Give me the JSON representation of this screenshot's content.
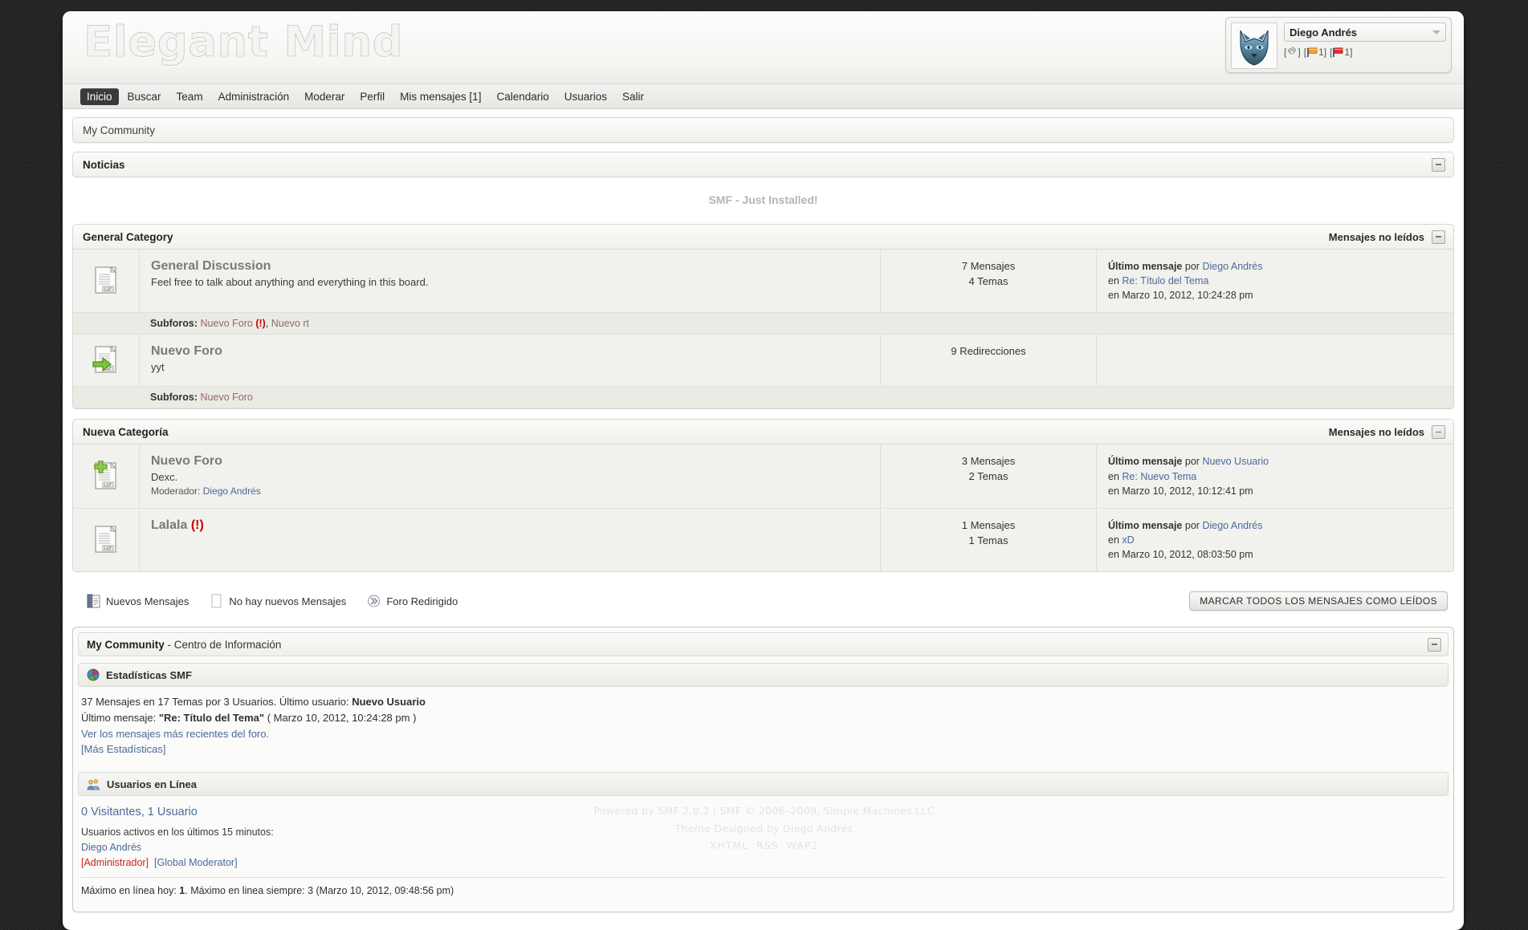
{
  "site": {
    "logo_text": "Elegant Mind",
    "breadcrumb": "My Community"
  },
  "user_panel": {
    "username": "Diego Andrés",
    "avatar_icon": "wolf-avatar",
    "settings_icon": "gear-icon",
    "unread_messages_icon": "orange-flag-icon",
    "unread_messages_count": "1",
    "alerts_icon": "red-flag-icon",
    "alerts_count": "1"
  },
  "nav": {
    "items": [
      {
        "label": "Inicio",
        "active": true
      },
      {
        "label": "Buscar",
        "active": false
      },
      {
        "label": "Team",
        "active": false
      },
      {
        "label": "Administración",
        "active": false
      },
      {
        "label": "Moderar",
        "active": false
      },
      {
        "label": "Perfil",
        "active": false
      },
      {
        "label": "Mis mensajes [1]",
        "active": false
      },
      {
        "label": "Calendario",
        "active": false
      },
      {
        "label": "Usuarios",
        "active": false
      },
      {
        "label": "Salir",
        "active": false
      }
    ]
  },
  "news": {
    "title": "Noticias",
    "text": "SMF - Just Installed!"
  },
  "categories": [
    {
      "title": "General Category",
      "unread_label": "Mensajes no leídos",
      "boards": [
        {
          "icon": "board-off-icon",
          "title": "General Discussion",
          "description": "Feel free to talk about anything and everything in this board.",
          "moderator_label": "",
          "moderator": "",
          "stats_line1": "7 Mensajes",
          "stats_line2": "4 Temas",
          "last_post_label": "Último mensaje",
          "last_post_by_prefix": "por",
          "last_post_author": "Diego Andrés",
          "last_post_in_prefix": "en",
          "last_post_topic": "Re: Título del Tema",
          "last_post_date_prefix": "en",
          "last_post_date": "Marzo 10, 2012, 10:24:28 pm",
          "subforums_label": "Subforos:",
          "subforums": [
            {
              "name": "Nuevo Foro",
              "new": true
            },
            {
              "name": "Nuevo rt",
              "new": false
            }
          ]
        },
        {
          "icon": "board-redirect-icon",
          "title": "Nuevo Foro",
          "description": "yyt",
          "moderator_label": "",
          "moderator": "",
          "stats_line1": "9 Redirecciones",
          "stats_line2": "",
          "last_post_label": "",
          "last_post_by_prefix": "",
          "last_post_author": "",
          "last_post_in_prefix": "",
          "last_post_topic": "",
          "last_post_date_prefix": "",
          "last_post_date": "",
          "subforums_label": "Subforos:",
          "subforums": [
            {
              "name": "Nuevo Foro",
              "new": false
            }
          ]
        }
      ]
    },
    {
      "title": "Nueva Categoría",
      "unread_label": "Mensajes no leídos",
      "boards": [
        {
          "icon": "board-new-icon",
          "title": "Nuevo Foro",
          "description": "Dexc.",
          "moderator_label": "Moderador:",
          "moderator": "Diego Andrés",
          "stats_line1": "3 Mensajes",
          "stats_line2": "2 Temas",
          "last_post_label": "Último mensaje",
          "last_post_by_prefix": "por",
          "last_post_author": "Nuevo Usuario",
          "last_post_in_prefix": "en",
          "last_post_topic": "Re: Nuevo Tema",
          "last_post_date_prefix": "en",
          "last_post_date": "Marzo 10, 2012, 10:12:41 pm",
          "subforums_label": "",
          "subforums": []
        },
        {
          "icon": "board-off-icon",
          "title": "Lalala",
          "title_new_mark": "(!)",
          "description": "",
          "moderator_label": "",
          "moderator": "",
          "stats_line1": "1 Mensajes",
          "stats_line2": "1 Temas",
          "last_post_label": "Último mensaje",
          "last_post_by_prefix": "por",
          "last_post_author": "Diego Andrés",
          "last_post_in_prefix": "en",
          "last_post_topic": "xD",
          "last_post_date_prefix": "en",
          "last_post_date": "Marzo 10, 2012, 08:03:50 pm",
          "subforums_label": "",
          "subforums": []
        }
      ]
    }
  ],
  "legend": {
    "new_posts": "Nuevos Mensajes",
    "no_new_posts": "No hay nuevos Mensajes",
    "redirect_board": "Foro Redirigido",
    "mark_all_read": "MARCAR TODOS LOS MENSAJES COMO LEÍDOS"
  },
  "info_center": {
    "title_strong": "My Community",
    "title_rest": " - Centro de Información",
    "stats": {
      "icon": "pie-chart-icon",
      "heading": "Estadísticas SMF",
      "line1_a": "37 Mensajes en 17 Temas por 3 Usuarios. Último usuario: ",
      "line1_user": "Nuevo Usuario",
      "line2_a": "Último mensaje: ",
      "line2_topic": "\"Re: Título del Tema\"",
      "line2_b": " ( Marzo 10, 2012, 10:24:28 pm )",
      "line3": "Ver los mensajes más recientes del foro.",
      "line4": "[Más Estadísticas]"
    },
    "online": {
      "icon": "users-icon",
      "heading": "Usuarios en Línea",
      "summary": "0 Visitantes, 1 Usuario",
      "active_label": "Usuarios activos en los últimos 15 minutos:",
      "users": [
        "Diego Andrés"
      ],
      "groups": [
        {
          "label": "[Administrador]",
          "color": "#cc2222"
        },
        {
          "label": "[Global Moderator]",
          "color": "#4b6a9b"
        }
      ],
      "max_today_a": "Máximo en línea hoy: ",
      "max_today_value": "1",
      "max_today_b": ". Máximo en linea siempre: 3 (Marzo 10, 2012, 09:48:56 pm)"
    }
  },
  "footer": {
    "line1": "Powered by SMF 2.0.2 | SMF © 2006–2009, Simple Machines LLC",
    "line2": "Theme Designed by Diego Andrés",
    "links": [
      "XHTML",
      "RSS",
      "WAP2"
    ]
  }
}
